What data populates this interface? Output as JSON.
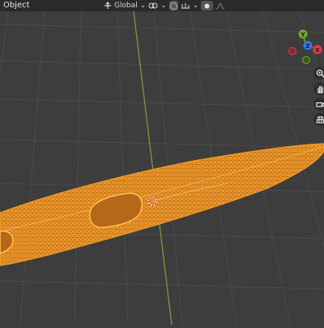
{
  "header": {
    "mode_label": "Object",
    "orientation_label": "Global",
    "chevron_glyph": "⌄"
  },
  "gizmo": {
    "axes": [
      {
        "label": "Y",
        "color": "#6ea82a"
      },
      {
        "label": "Z",
        "color": "#2f7ce6"
      },
      {
        "label": "X",
        "color": "#e6394f"
      }
    ]
  },
  "colors": {
    "viewport_bg": "#3d3d3d",
    "grid_line": "#4a4a4a",
    "selection_orange": "#f39a26",
    "y_axis_line": "#7ea23a"
  },
  "icons": [
    "zoom-icon",
    "hand-pan-icon",
    "camera-icon",
    "perspective-grid-icon"
  ]
}
